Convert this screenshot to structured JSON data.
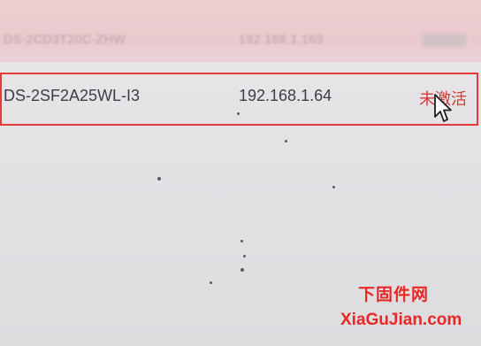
{
  "device_list": {
    "previous_row": {
      "model": "DS-2CD3T20C-ZHW",
      "ip": "192.168.1.169"
    },
    "selected_row": {
      "model": "DS-2SF2A25WL-I3",
      "ip": "192.168.1.64",
      "status": "未激活"
    }
  },
  "watermark": {
    "cn": "下固件网",
    "url": "XiaGuJian.com"
  },
  "colors": {
    "highlight_border": "#e53a3a",
    "status_inactive": "#d63a3a",
    "watermark": "#e82828"
  }
}
